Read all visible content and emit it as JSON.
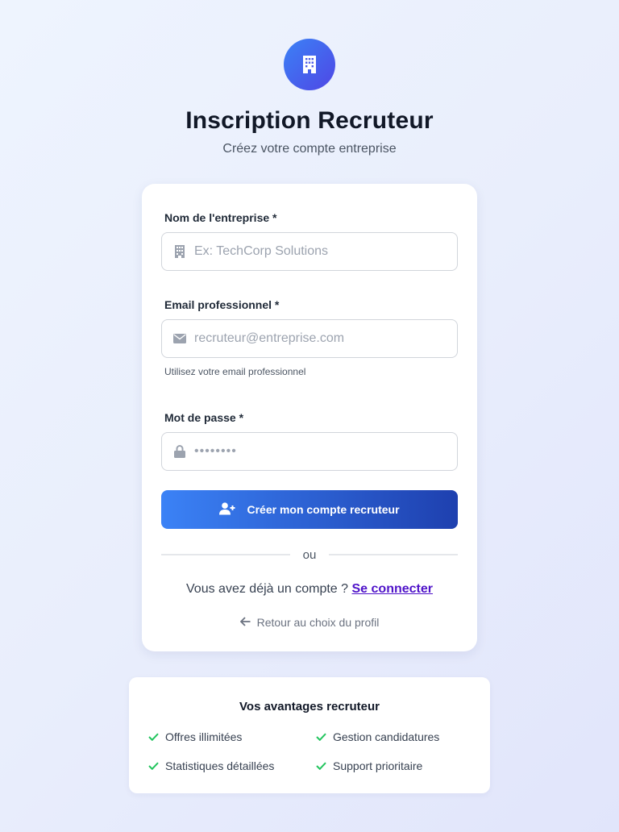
{
  "header": {
    "title": "Inscription Recruteur",
    "subtitle": "Créez votre compte entreprise",
    "logo_icon": "building-icon"
  },
  "form": {
    "company": {
      "label": "Nom de l'entreprise *",
      "placeholder": "Ex: TechCorp Solutions",
      "value": "",
      "icon": "building-icon"
    },
    "email": {
      "label": "Email professionnel *",
      "placeholder": "recruteur@entreprise.com",
      "value": "",
      "hint": "Utilisez votre email professionnel",
      "icon": "envelope-icon"
    },
    "password": {
      "label": "Mot de passe *",
      "placeholder": "••••••••",
      "value": "",
      "icon": "lock-icon"
    },
    "submit_label": "Créer mon compte recruteur",
    "submit_icon": "user-plus-icon",
    "divider_text": "ou",
    "login_prompt": "Vous avez déjà un compte ?",
    "login_link": "Se connecter",
    "back_label": "Retour au choix du profil",
    "back_icon": "arrow-left-icon"
  },
  "benefits": {
    "title": "Vos avantages recruteur",
    "items": [
      "Offres illimitées",
      "Gestion candidatures",
      "Statistiques détaillées",
      "Support prioritaire"
    ]
  },
  "colors": {
    "accent": "#3b82f6",
    "accent_dark": "#1e40af",
    "link": "#4f13c9",
    "check": "#22c55e"
  }
}
